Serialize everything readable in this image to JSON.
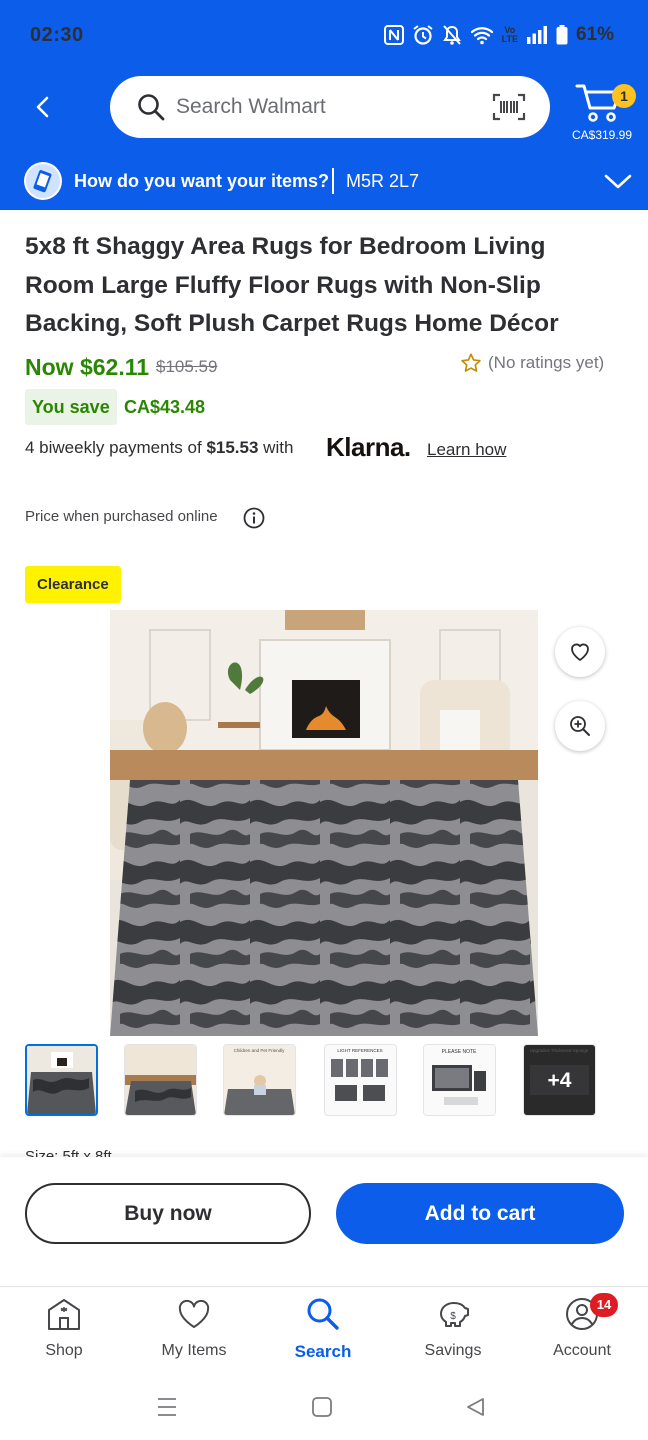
{
  "status_bar": {
    "time": "02:30",
    "battery": "61%",
    "lte_top": "Vo",
    "lte_bottom": "LTE"
  },
  "header": {
    "search_placeholder": "Search Walmart",
    "cart_count": "1",
    "cart_total": "CA$319.99"
  },
  "delivery": {
    "question": "How do you want your items?",
    "postal_code": "M5R 2L7"
  },
  "product": {
    "title": "5x8 ft Shaggy Area Rugs for Bedroom Living Room Large Fluffy Floor Rugs with Non-Slip Backing, Soft Plush Carpet Rugs Home Décor",
    "price_now": "Now $62.11",
    "price_was": "$105.59",
    "rating_text": "(No ratings yet)",
    "you_save_label": "You save",
    "you_save_amount": "CA$43.48",
    "klarna_prefix": "4 biweekly payments of",
    "klarna_amount": "$15.53",
    "klarna_suffix": "with",
    "klarna_logo": "Klarna.",
    "learn_how": "Learn how",
    "price_online": "Price when purchased online",
    "badge": "Clearance",
    "size_peek": "Size: 5ft x 8ft"
  },
  "thumbnails": {
    "count_selected": 1,
    "more_label": "+4",
    "captions": [
      "",
      "",
      "Children and Pet Friendly",
      "LIGHT REFERENCES",
      "PLEASE NOTE",
      "Upgraded Thickened Sponge"
    ]
  },
  "actions": {
    "buy_now": "Buy now",
    "add_to_cart": "Add to cart"
  },
  "nav": {
    "items": [
      {
        "label": "Shop",
        "icon": "store-icon"
      },
      {
        "label": "My Items",
        "icon": "heart-icon"
      },
      {
        "label": "Search",
        "icon": "search-icon"
      },
      {
        "label": "Savings",
        "icon": "piggy-bank-icon"
      },
      {
        "label": "Account",
        "icon": "account-icon"
      }
    ],
    "active": "Search",
    "account_badge": "14"
  },
  "colors": {
    "walmart_blue": "#0b5dea",
    "price_green": "#2a8703",
    "spark_yellow": "#ffc220",
    "clearance_yellow": "#fff200",
    "badge_red": "#de1c24"
  }
}
